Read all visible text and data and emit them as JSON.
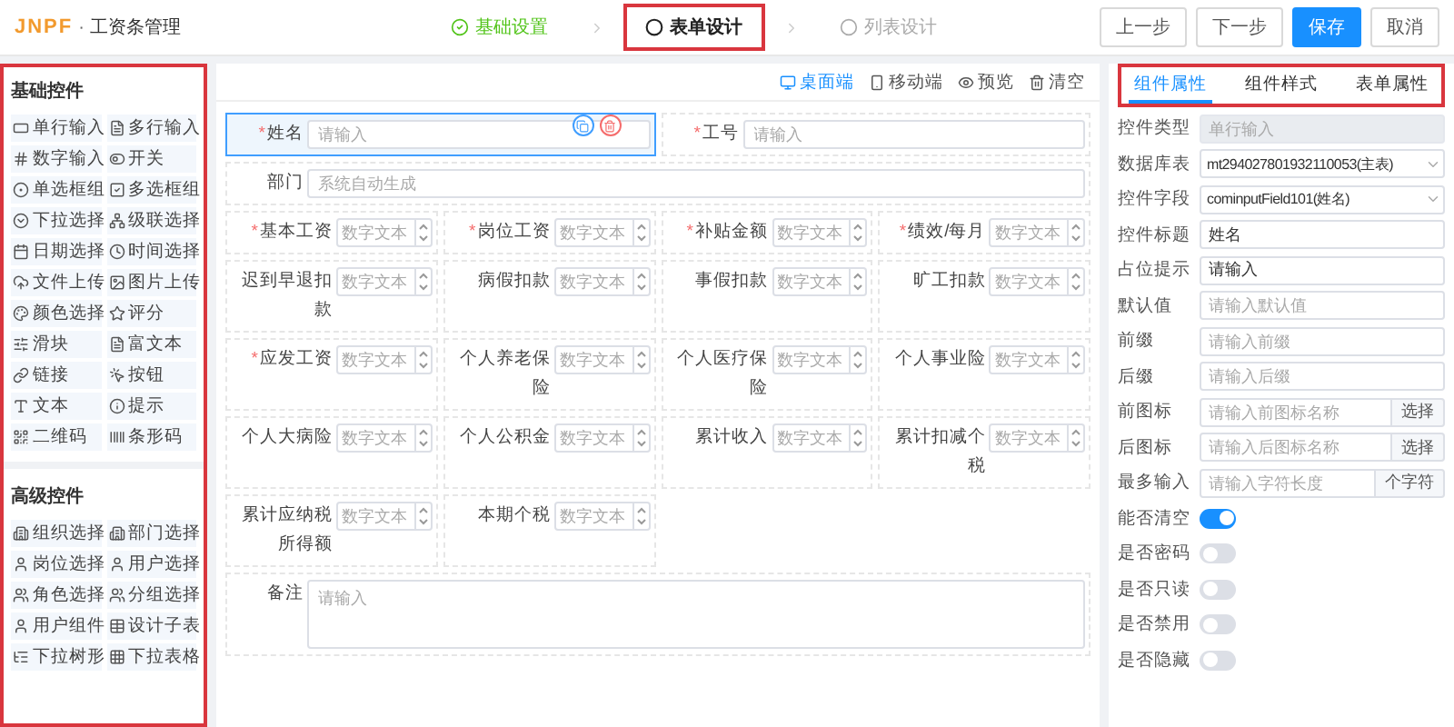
{
  "header": {
    "logo": "JNPF",
    "separator": "·",
    "title": "工资条管理"
  },
  "steps": [
    {
      "label": "基础设置",
      "kind": "done",
      "highlighted": false
    },
    {
      "label": "表单设计",
      "kind": "current",
      "highlighted": true
    },
    {
      "label": "列表设计",
      "kind": "todo",
      "highlighted": false
    }
  ],
  "actions": [
    {
      "label": "上一步",
      "primary": false
    },
    {
      "label": "下一步",
      "primary": false
    },
    {
      "label": "保存",
      "primary": true
    },
    {
      "label": "取消",
      "primary": false
    }
  ],
  "palette": {
    "highlighted": true,
    "groups": [
      {
        "title": "基础控件",
        "items": [
          {
            "label": "单行输入",
            "kind": "input"
          },
          {
            "label": "多行输入",
            "kind": "textarea"
          },
          {
            "label": "数字输入",
            "kind": "number"
          },
          {
            "label": "开关",
            "kind": "switch"
          },
          {
            "label": "单选框组",
            "kind": "radio"
          },
          {
            "label": "多选框组",
            "kind": "checkbox"
          },
          {
            "label": "下拉选择",
            "kind": "select"
          },
          {
            "label": "级联选择",
            "kind": "cascader"
          },
          {
            "label": "日期选择",
            "kind": "date"
          },
          {
            "label": "时间选择",
            "kind": "time"
          },
          {
            "label": "文件上传",
            "kind": "upload"
          },
          {
            "label": "图片上传",
            "kind": "image"
          },
          {
            "label": "颜色选择",
            "kind": "color"
          },
          {
            "label": "评分",
            "kind": "rate"
          },
          {
            "label": "滑块",
            "kind": "slider"
          },
          {
            "label": "富文本",
            "kind": "richtext"
          },
          {
            "label": "链接",
            "kind": "link"
          },
          {
            "label": "按钮",
            "kind": "button"
          },
          {
            "label": "文本",
            "kind": "text"
          },
          {
            "label": "提示",
            "kind": "alert"
          },
          {
            "label": "二维码",
            "kind": "qrcode"
          },
          {
            "label": "条形码",
            "kind": "barcode"
          }
        ]
      },
      {
        "title": "高级控件",
        "items": [
          {
            "label": "组织选择",
            "kind": "org"
          },
          {
            "label": "部门选择",
            "kind": "org"
          },
          {
            "label": "岗位选择",
            "kind": "user"
          },
          {
            "label": "用户选择",
            "kind": "user"
          },
          {
            "label": "角色选择",
            "kind": "users"
          },
          {
            "label": "分组选择",
            "kind": "users"
          },
          {
            "label": "用户组件",
            "kind": "user"
          },
          {
            "label": "设计子表",
            "kind": "table"
          },
          {
            "label": "下拉树形",
            "kind": "tree"
          },
          {
            "label": "下拉表格",
            "kind": "grid"
          }
        ]
      }
    ]
  },
  "canvas": {
    "devices": [
      {
        "label": "桌面端",
        "kind": "desktop",
        "selected": true
      },
      {
        "label": "移动端",
        "kind": "mobile",
        "selected": false
      }
    ],
    "tools": [
      {
        "label": "预览",
        "kind": "preview"
      },
      {
        "label": "清空",
        "kind": "clear"
      }
    ],
    "rows": [
      {
        "fields": [
          {
            "mark": "*",
            "label": "姓名",
            "kind": "text",
            "placeholder": "请输入",
            "selected": true
          },
          {
            "mark": "*",
            "label": "工号",
            "kind": "text",
            "placeholder": "请输入",
            "selected": false
          }
        ]
      },
      {
        "fields": [
          {
            "label": "部门",
            "kind": "text",
            "placeholder": "系统自动生成",
            "selected": false
          }
        ]
      },
      {
        "fields": [
          {
            "mark": "*",
            "label": "基本工资",
            "kind": "number",
            "placeholder": "数字文本",
            "selected": false
          },
          {
            "mark": "*",
            "label": "岗位工资",
            "kind": "number",
            "placeholder": "数字文本",
            "selected": false
          },
          {
            "mark": "*",
            "label": "补贴金额",
            "kind": "number",
            "placeholder": "数字文本",
            "selected": false
          },
          {
            "mark": "*",
            "label": "绩效/每月",
            "kind": "number",
            "placeholder": "数字文本",
            "selected": false
          }
        ]
      },
      {
        "fields": [
          {
            "label": "迟到早退扣款",
            "kind": "number",
            "placeholder": "数字文本",
            "selected": false
          },
          {
            "label": "病假扣款",
            "kind": "number",
            "placeholder": "数字文本",
            "selected": false
          },
          {
            "label": "事假扣款",
            "kind": "number",
            "placeholder": "数字文本",
            "selected": false
          },
          {
            "label": "旷工扣款",
            "kind": "number",
            "placeholder": "数字文本",
            "selected": false
          }
        ]
      },
      {
        "fields": [
          {
            "mark": "*",
            "label": "应发工资",
            "kind": "number",
            "placeholder": "数字文本",
            "selected": false
          },
          {
            "label": "个人养老保险",
            "kind": "number",
            "placeholder": "数字文本",
            "selected": false
          },
          {
            "label": "个人医疗保险",
            "kind": "number",
            "placeholder": "数字文本",
            "selected": false
          },
          {
            "label": "个人事业险",
            "kind": "number",
            "placeholder": "数字文本",
            "selected": false
          }
        ]
      },
      {
        "fields": [
          {
            "label": "个人大病险",
            "kind": "number",
            "placeholder": "数字文本",
            "selected": false
          },
          {
            "label": "个人公积金",
            "kind": "number",
            "placeholder": "数字文本",
            "selected": false
          },
          {
            "label": "累计收入",
            "kind": "number",
            "placeholder": "数字文本",
            "selected": false
          },
          {
            "label": "累计扣减个税",
            "kind": "number",
            "placeholder": "数字文本",
            "selected": false
          }
        ]
      },
      {
        "fields": [
          {
            "label": "累计应纳税所得额",
            "kind": "number",
            "placeholder": "数字文本",
            "selected": false
          },
          {
            "label": "本期个税",
            "kind": "number",
            "placeholder": "数字文本",
            "selected": false
          }
        ]
      },
      {
        "fields": [
          {
            "label": "备注",
            "kind": "textarea",
            "placeholder": "请输入",
            "selected": false
          }
        ]
      }
    ]
  },
  "properties": {
    "highlighted": true,
    "tabs": [
      {
        "label": "组件属性",
        "selected": true
      },
      {
        "label": "组件样式",
        "selected": false
      },
      {
        "label": "表单属性",
        "selected": false
      }
    ],
    "rows": [
      {
        "label": "控件类型",
        "kind": "input",
        "placeholder": "单行输入",
        "disabled": true
      },
      {
        "label": "数据库表",
        "kind": "select",
        "value": "mt294027801932110053(主表)"
      },
      {
        "label": "控件字段",
        "kind": "select",
        "value": "cominputField101(姓名)"
      },
      {
        "label": "控件标题",
        "kind": "input",
        "value": "姓名",
        "disabled": false
      },
      {
        "label": "占位提示",
        "kind": "input",
        "value": "请输入",
        "disabled": false
      },
      {
        "label": "默认值",
        "kind": "input",
        "placeholder": "请输入默认值",
        "disabled": false
      },
      {
        "label": "前缀",
        "kind": "input",
        "placeholder": "请输入前缀",
        "disabled": false
      },
      {
        "label": "后缀",
        "kind": "input",
        "placeholder": "请输入后缀",
        "disabled": false
      },
      {
        "label": "前图标",
        "kind": "addon",
        "placeholder": "请输入前图标名称",
        "addon": "选择"
      },
      {
        "label": "后图标",
        "kind": "addon",
        "placeholder": "请输入后图标名称",
        "addon": "选择"
      },
      {
        "label": "最多输入",
        "kind": "addon",
        "placeholder": "请输入字符长度",
        "addon": "个字符"
      },
      {
        "label": "能否清空",
        "kind": "switch",
        "on": true
      },
      {
        "label": "是否密码",
        "kind": "switch",
        "on": false
      },
      {
        "label": "是否只读",
        "kind": "switch",
        "on": false
      },
      {
        "label": "是否禁用",
        "kind": "switch",
        "on": false
      },
      {
        "label": "是否隐藏",
        "kind": "switch",
        "on": false
      }
    ]
  }
}
